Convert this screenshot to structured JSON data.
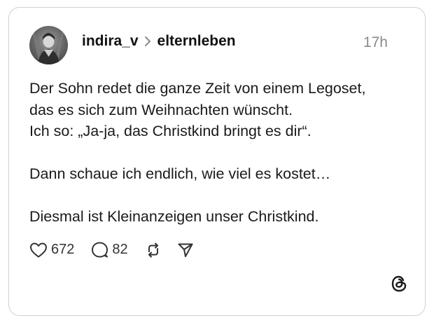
{
  "post": {
    "username": "indira_v",
    "community": "elternleben",
    "timestamp": "17h",
    "lines": [
      "Der Sohn redet die ganze Zeit von einem Legoset,",
      "das es sich zum Weihnachten wünscht.",
      "Ich so: „Ja-ja, das Christkind bringt es dir“.",
      "Dann schaue ich endlich, wie viel es kostet…",
      "Diesmal ist Kleinanzeigen unser Christkind."
    ]
  },
  "actions": {
    "likes": "672",
    "comments": "82",
    "icons": [
      "heart-icon",
      "comment-icon",
      "repost-icon",
      "share-icon"
    ]
  },
  "branding": {
    "logo": "threads-logo-icon"
  },
  "colors": {
    "text": "#1a1a1a",
    "muted": "#8a8a8a",
    "border": "#d0d0d0"
  }
}
